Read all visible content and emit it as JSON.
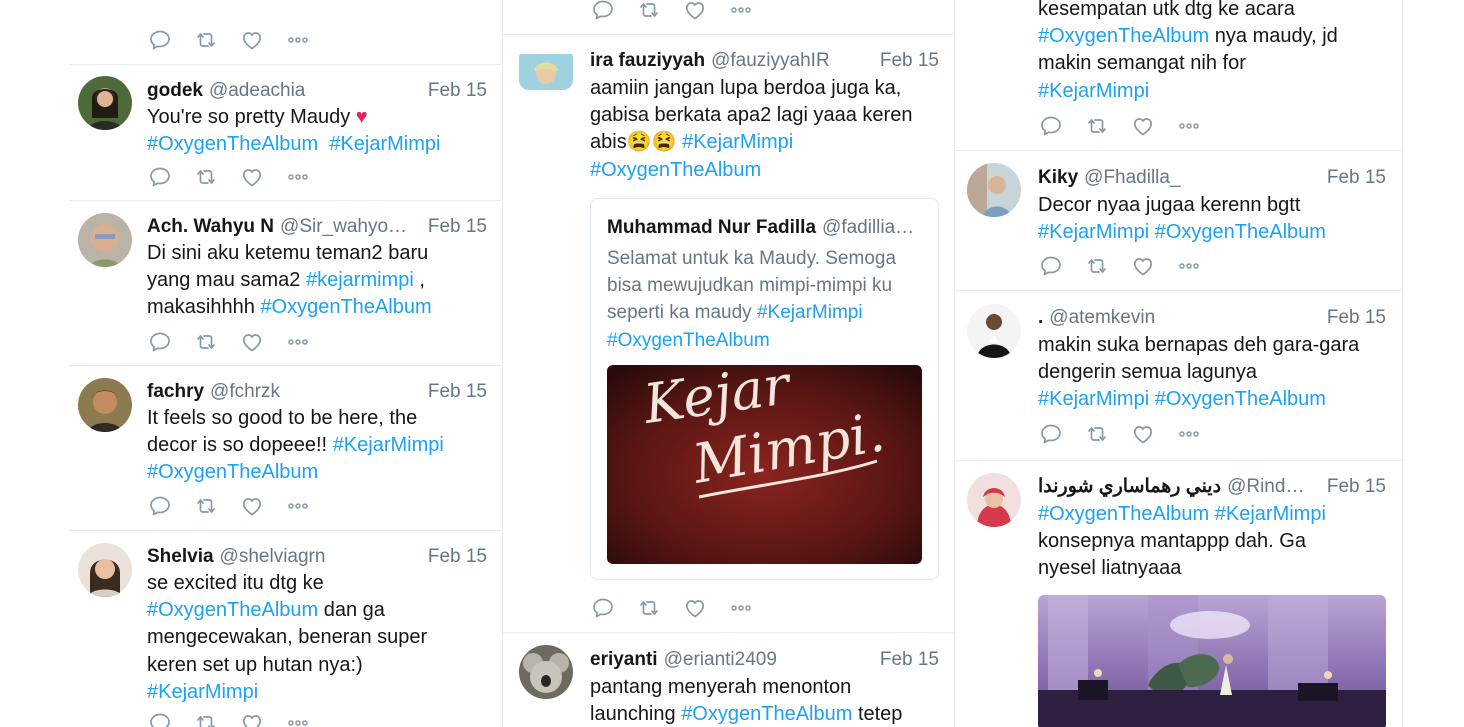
{
  "colors": {
    "link": "#1da1f2",
    "muted": "#657786",
    "text": "#14171a",
    "heart": "#e0245e"
  },
  "icons": [
    "reply-icon",
    "retweet-icon",
    "like-icon",
    "more-icon"
  ],
  "col1": {
    "tweets": [
      {
        "name": "godek",
        "handle": "@adeachia",
        "date": "Feb 15",
        "line1": "You're so pretty Maudy",
        "heart": "♥",
        "tag1": "#OxygenTheAlbum",
        "tag2": "#KejarMimpi"
      },
      {
        "name": "Ach. Wahyu N",
        "handle": "@Sir_wahyo…",
        "date": "Feb 15",
        "line1": "Di sini aku ketemu teman2 baru",
        "line2": "yang mau sama2 ",
        "tag1": "#kejarmimpi",
        "line2b": " ,",
        "line3": "makasihhhh ",
        "tag2": "#OxygenTheAlbum"
      },
      {
        "name": "fachry",
        "handle": "@fchrzk",
        "date": "Feb 15",
        "line1": "It feels so good to be here, the",
        "line2": "decor is so dopeee!! ",
        "tag1": "#KejarMimpi",
        "tag2": "#OxygenTheAlbum"
      },
      {
        "name": "Shelvia",
        "handle": "@shelviagrn",
        "date": "Feb 15",
        "line1": "se excited itu dtg ke",
        "tag1": "#OxygenTheAlbum",
        "line2": " dan ga",
        "line3": "mengecewakan, beneran super",
        "line4": "keren set up hutan nya:)",
        "tag2": "#KejarMimpi"
      }
    ]
  },
  "col2": {
    "tweets": [
      {
        "name": "ira fauziyyah",
        "handle": "@fauziyyahIR",
        "date": "Feb 15",
        "line1": "aamiin jangan lupa berdoa juga ka,",
        "line2": "gabisa berkata apa2 lagi yaaa keren",
        "line3": "abis",
        "emoji": "😫😫",
        "tag1": "#KejarMimpi",
        "tag2": "#OxygenTheAlbum",
        "quote": {
          "name": "Muhammad Nur Fadilla",
          "handle": "@fadillia…",
          "line1": "Selamat untuk ka Maudy. Semoga",
          "line2": "bisa mewujudkan mimpi-mimpi ku",
          "line3": "seperti ka maudy ",
          "tag1": "#KejarMimpi",
          "tag2": "#OxygenTheAlbum",
          "image_text1": "Kejar",
          "image_text2": "Mimpi."
        }
      },
      {
        "name": "eriyanti",
        "handle": "@erianti2409",
        "date": "Feb 15",
        "line1": "pantang menyerah menonton",
        "line2": "launching ",
        "tag1": "#OxygenTheAlbum",
        "line2b": " tetep"
      }
    ]
  },
  "col3": {
    "tweets": [
      {
        "line1": "kesempatan utk dtg ke acara",
        "tag1": "#OxygenTheAlbum",
        "line2": " nya maudy, jd",
        "line3": "makin semangat nih for",
        "tag2": "#KejarMimpi"
      },
      {
        "name": "Kiky",
        "handle": "@Fhadilla_",
        "date": "Feb 15",
        "line1": "Decor nyaa jugaa kerenn bgtt",
        "tag1": "#KejarMimpi",
        "tag2": "#OxygenTheAlbum"
      },
      {
        "name": ".",
        "handle": "@atemkevin",
        "date": "Feb 15",
        "line1": "makin suka bernapas deh gara-gara",
        "line2": "dengerin semua lagunya",
        "tag1": "#KejarMimpi",
        "tag2": "#OxygenTheAlbum"
      },
      {
        "name": "ديني رهماساري شورندا",
        "handle": "@Rindoong",
        "date": "Feb 15",
        "tag1": "#OxygenTheAlbum",
        "tag2": "#KejarMimpi",
        "line1": "konsepnya mantappp dah. Ga",
        "line2": "nyesel liatnyaaa"
      }
    ]
  }
}
